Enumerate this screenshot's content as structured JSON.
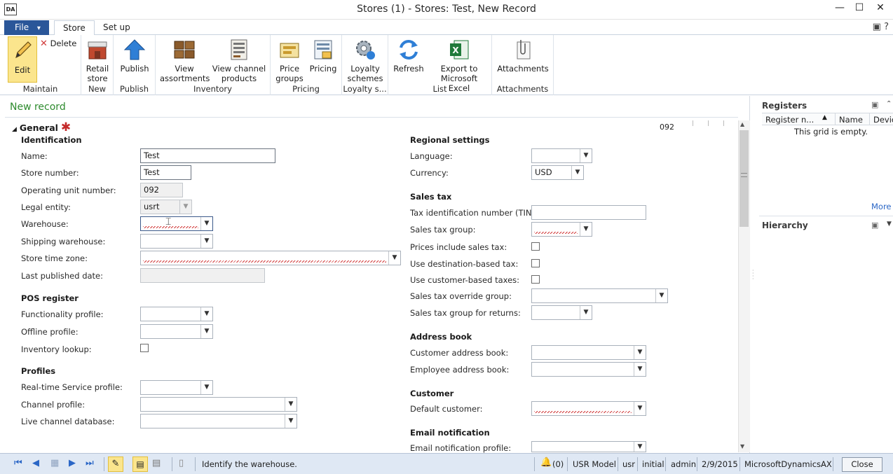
{
  "window": {
    "title": "Stores (1) - Stores: Test, New Record",
    "app_icon_text": "DA",
    "minimize": "—",
    "maximize": "☐",
    "close": "✕"
  },
  "tabs": {
    "file": "File",
    "file_arrow": "▾",
    "store": "Store",
    "setup": "Set up",
    "right_icons": "▣  ?"
  },
  "ribbon": {
    "maintain": {
      "label": "Maintain",
      "edit": "Edit",
      "delete": "Delete"
    },
    "new": {
      "label": "New",
      "retail_store": "Retail store"
    },
    "publish": {
      "label": "Publish",
      "publish": "Publish"
    },
    "inventory": {
      "label": "Inventory",
      "view_assortments": "View assortments",
      "view_channel_products": "View channel products"
    },
    "pricing": {
      "label": "Pricing",
      "price_groups": "Price groups",
      "pricing": "Pricing"
    },
    "loyalty": {
      "label": "Loyalty s...",
      "loyalty_schemes": "Loyalty schemes"
    },
    "list": {
      "label": "List",
      "refresh": "Refresh",
      "export_excel": "Export to Microsoft Excel"
    },
    "attachments": {
      "label": "Attachments",
      "attachments": "Attachments"
    }
  },
  "form": {
    "status": "New record",
    "section_title": "General",
    "record_id": "092",
    "identification": {
      "title": "Identification",
      "name_label": "Name:",
      "name_value": "Test",
      "store_number_label": "Store number:",
      "store_number_value": "Test",
      "operating_unit_label": "Operating unit number:",
      "operating_unit_value": "092",
      "legal_entity_label": "Legal entity:",
      "legal_entity_value": "usrt",
      "warehouse_label": "Warehouse:",
      "shipping_warehouse_label": "Shipping warehouse:",
      "store_time_zone_label": "Store time zone:",
      "last_published_label": "Last published date:"
    },
    "pos_register": {
      "title": "POS register",
      "functionality_profile_label": "Functionality profile:",
      "offline_profile_label": "Offline profile:",
      "inventory_lookup_label": "Inventory lookup:"
    },
    "profiles": {
      "title": "Profiles",
      "realtime_label": "Real-time Service profile:",
      "channel_profile_label": "Channel profile:",
      "live_channel_db_label": "Live channel database:"
    },
    "regional": {
      "title": "Regional settings",
      "language_label": "Language:",
      "currency_label": "Currency:",
      "currency_value": "USD"
    },
    "sales_tax": {
      "title": "Sales tax",
      "tin_label": "Tax identification number (TIN):",
      "group_label": "Sales tax group:",
      "prices_include_label": "Prices include sales tax:",
      "destination_label": "Use destination-based tax:",
      "customer_based_label": "Use customer-based taxes:",
      "override_label": "Sales tax override group:",
      "returns_label": "Sales tax group for returns:"
    },
    "address_book": {
      "title": "Address book",
      "customer_label": "Customer address book:",
      "employee_label": "Employee address book:"
    },
    "customer": {
      "title": "Customer",
      "default_label": "Default customer:"
    },
    "email": {
      "title": "Email notification",
      "profile_label": "Email notification profile:"
    }
  },
  "factbox": {
    "registers_title": "Registers",
    "col_register": "Register n...",
    "col_name": "Name",
    "col_device": "Devic",
    "empty": "This grid is empty.",
    "more": "More",
    "hierarchy_title": "Hierarchy"
  },
  "statusbar": {
    "help": "Identify the warehouse.",
    "alerts": "(0)",
    "model": "USR Model",
    "company": "usr",
    "layer": "initial",
    "user": "admin",
    "date": "2/9/2015",
    "app": "MicrosoftDynamicsAX",
    "close": "Close"
  },
  "colors": {
    "accent": "#2a5699",
    "new_record": "#2e8b2e",
    "required": "#c42a2a",
    "edit_highlight": "#fbe58d",
    "statusbar": "#dfe8f4"
  }
}
